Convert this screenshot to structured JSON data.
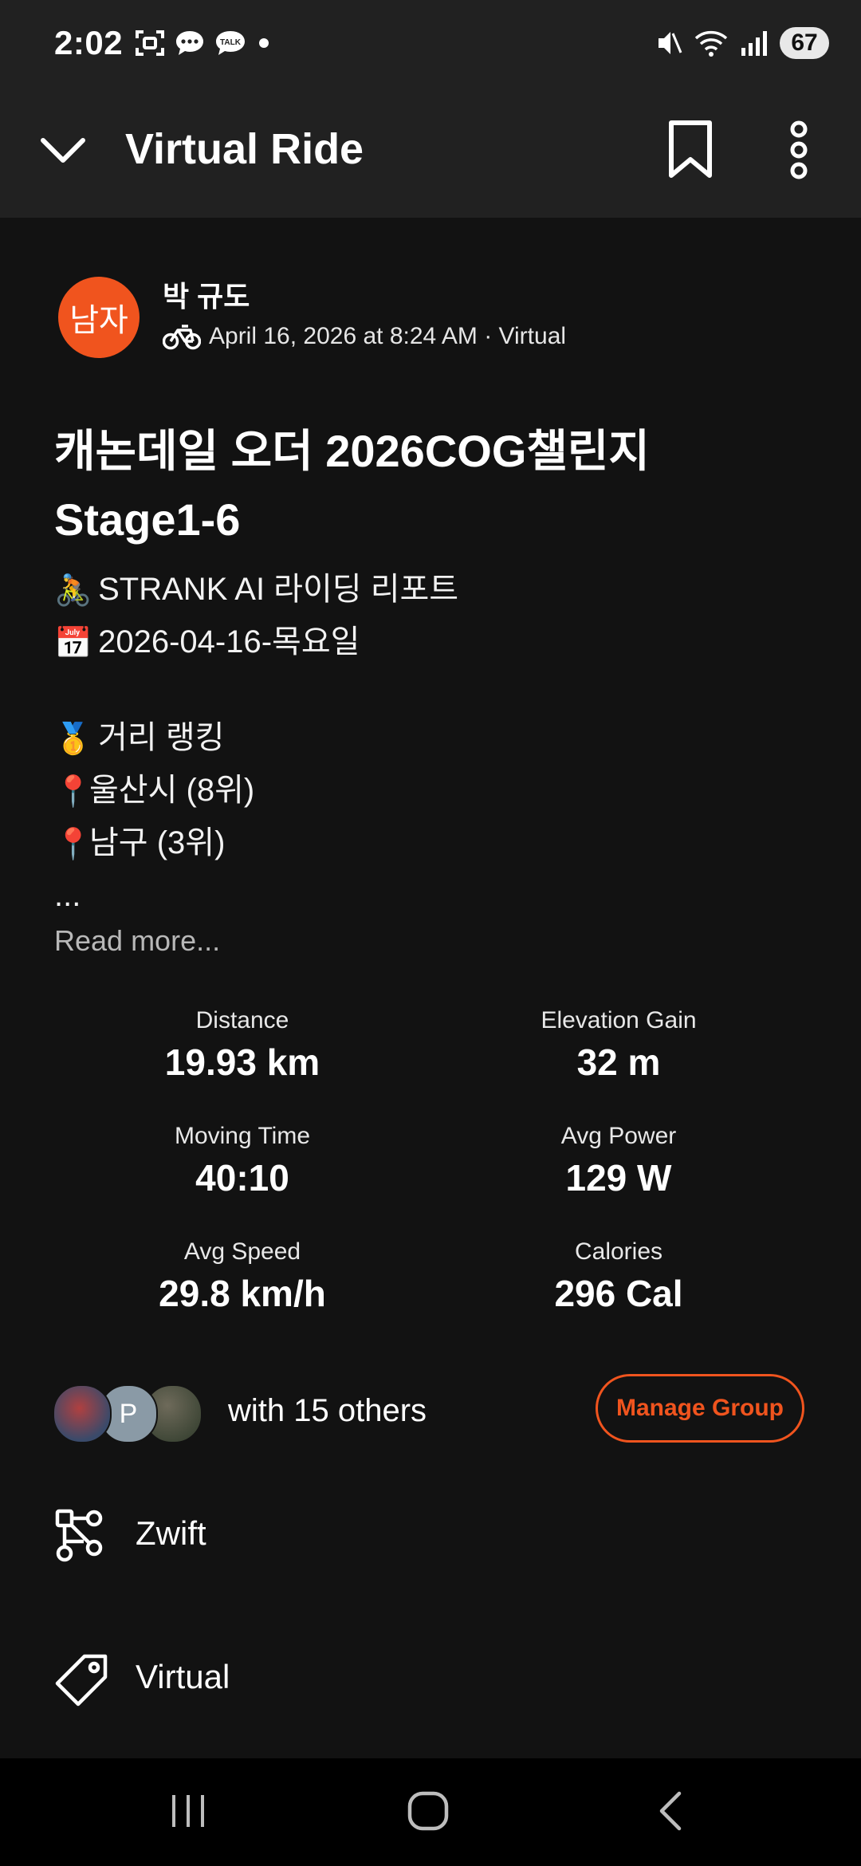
{
  "status_bar": {
    "time": "2:02",
    "battery": "67"
  },
  "header": {
    "title": "Virtual Ride"
  },
  "athlete": {
    "avatar_text": "남자",
    "name": "박 규도",
    "meta": "April 16, 2026 at 8:24 AM · Virtual"
  },
  "activity": {
    "title": "캐논데일 오더 2026COG챌린지 Stage1-6",
    "description_lines": [
      {
        "emoji": "🚴",
        "text": "STRANK AI 라이딩 리포트"
      },
      {
        "emoji": "📅",
        "text": "2026-04-16-목요일"
      },
      {
        "emoji": "🥇",
        "text": "거리 랭킹"
      },
      {
        "emoji": "📍",
        "text": "울산시 (8위)"
      },
      {
        "emoji": "📍",
        "text": "남구 (3위)"
      }
    ],
    "ellipsis": "...",
    "read_more": "Read more..."
  },
  "stats": [
    {
      "label": "Distance",
      "value": "19.93 km"
    },
    {
      "label": "Elevation Gain",
      "value": "32 m"
    },
    {
      "label": "Moving Time",
      "value": "40:10"
    },
    {
      "label": "Avg Power",
      "value": "129 W"
    },
    {
      "label": "Avg Speed",
      "value": "29.8 km/h"
    },
    {
      "label": "Calories",
      "value": "296 Cal"
    }
  ],
  "group": {
    "avatar_letter": "P",
    "with_text": "with 15 others",
    "manage_label": "Manage Group"
  },
  "details": {
    "device": "Zwift",
    "tag": "Virtual"
  },
  "colors": {
    "accent": "#f0541e",
    "background": "#121212",
    "appbar": "#212121"
  }
}
